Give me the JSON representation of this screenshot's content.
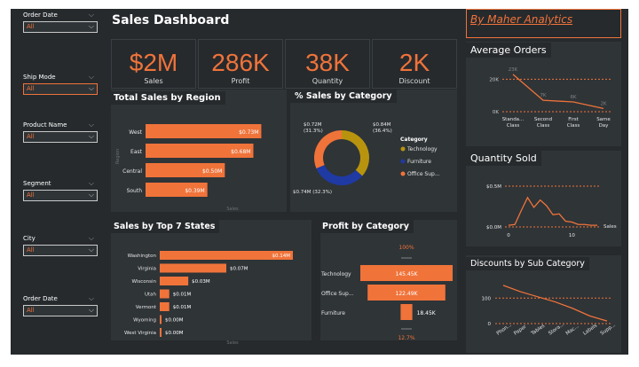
{
  "dashboard": {
    "title": "Sales Dashboard",
    "brand": "By Maher Analytics",
    "colors": {
      "accent": "#f0733a",
      "bg": "#262a2d",
      "panel": "#2f3437",
      "gold": "#b8940e",
      "navy": "#1f3aa3"
    }
  },
  "filters": [
    {
      "label": "Order Date",
      "value": "All",
      "active": false
    },
    {
      "label": "Ship Mode",
      "value": "All",
      "active": true
    },
    {
      "label": "Product Name",
      "value": "All",
      "active": false
    },
    {
      "label": "Segment",
      "value": "All",
      "active": false
    },
    {
      "label": "City",
      "value": "All",
      "active": false
    },
    {
      "label": "Order Date",
      "value": "All",
      "active": false
    }
  ],
  "kpis": [
    {
      "value": "$2M",
      "label": "Sales"
    },
    {
      "value": "286K",
      "label": "Profit"
    },
    {
      "value": "38K",
      "label": "Quantity"
    },
    {
      "value": "2K",
      "label": "Discount"
    }
  ],
  "chart_data": [
    {
      "id": "region",
      "type": "bar",
      "orientation": "horizontal",
      "title": "Total Sales by Region",
      "xlabel": "Sales",
      "ylabel": "Region",
      "categories": [
        "West",
        "East",
        "Central",
        "South"
      ],
      "values": [
        0.73,
        0.68,
        0.5,
        0.39
      ],
      "data_labels": [
        "$0.73M",
        "$0.68M",
        "$0.50M",
        "$0.39M"
      ],
      "xlim": [
        0,
        0.75
      ]
    },
    {
      "id": "category",
      "type": "pie",
      "donut": true,
      "title": "% Sales by Category",
      "legend_title": "Category",
      "legend_position": "right",
      "slices": [
        {
          "name": "Technology",
          "value": 0.84,
          "label": "$0.84M (36.4%)",
          "color": "#b8940e"
        },
        {
          "name": "Furniture",
          "value": 0.74,
          "label": "$0.74M (32.3%)",
          "color": "#1f3aa3"
        },
        {
          "name": "Office Sup...",
          "value": 0.72,
          "label": "$0.72M (31.3%)",
          "color": "#f0733a"
        }
      ]
    },
    {
      "id": "states",
      "type": "bar",
      "orientation": "horizontal",
      "title": "Sales by Top 7 States",
      "xlabel": "Sales",
      "ylabel": "State",
      "categories": [
        "Washington",
        "Virginia",
        "Wisconsin",
        "Utah",
        "Vermont",
        "Wyoming",
        "West Virginia"
      ],
      "values": [
        0.14,
        0.07,
        0.03,
        0.01,
        0.01,
        0.0,
        0.0
      ],
      "data_labels": [
        "$0.14M",
        "$0.07M",
        "$0.03M",
        "$0.01M",
        "$0.01M",
        "$0.00M",
        "$0.00M"
      ],
      "xlim": [
        0,
        0.14
      ]
    },
    {
      "id": "profit",
      "type": "bar",
      "orientation": "funnel",
      "title": "Profit by Category",
      "top_label": "100%",
      "bottom_label": "12.7%",
      "categories": [
        "Technology",
        "Office Sup...",
        "Furniture"
      ],
      "values": [
        145.45,
        122.49,
        18.45
      ],
      "data_labels": [
        "145.45K",
        "122.49K",
        "18.45K"
      ]
    },
    {
      "id": "avg_orders",
      "type": "line",
      "title": "Average Orders",
      "categories": [
        "Standa... Class",
        "Second Class",
        "First Class",
        "Same Day"
      ],
      "values": [
        23,
        7,
        6,
        2
      ],
      "data_labels": [
        "23K",
        "7K",
        "6K",
        "2K"
      ],
      "yticks": [
        "0K",
        "20K"
      ],
      "ylim": [
        0,
        24
      ]
    },
    {
      "id": "qty_sold",
      "type": "line",
      "title": "Quantity Sold",
      "xlabel": "Sales",
      "x": [
        0,
        1,
        2,
        3,
        4,
        5,
        6,
        7,
        8,
        9,
        10,
        11,
        12,
        13,
        14
      ],
      "values": [
        0.02,
        0.03,
        0.2,
        0.36,
        0.24,
        0.33,
        0.26,
        0.15,
        0.16,
        0.07,
        0.06,
        0.03,
        0.03,
        0.02,
        0.02
      ],
      "xticks": [
        "0",
        "10"
      ],
      "yticks": [
        "$0.0M",
        "$0.5M"
      ],
      "ylim": [
        0,
        0.5
      ]
    },
    {
      "id": "discounts",
      "type": "line",
      "title": "Discounts by Sub Category",
      "categories": [
        "Phon...",
        "Paper",
        "Tables",
        "Stora...",
        "Mac...",
        "Labels",
        "Supp..."
      ],
      "values": [
        150,
        125,
        105,
        85,
        60,
        30,
        10
      ],
      "yticks": [
        "0",
        "100"
      ],
      "ylim": [
        0,
        160
      ]
    }
  ]
}
